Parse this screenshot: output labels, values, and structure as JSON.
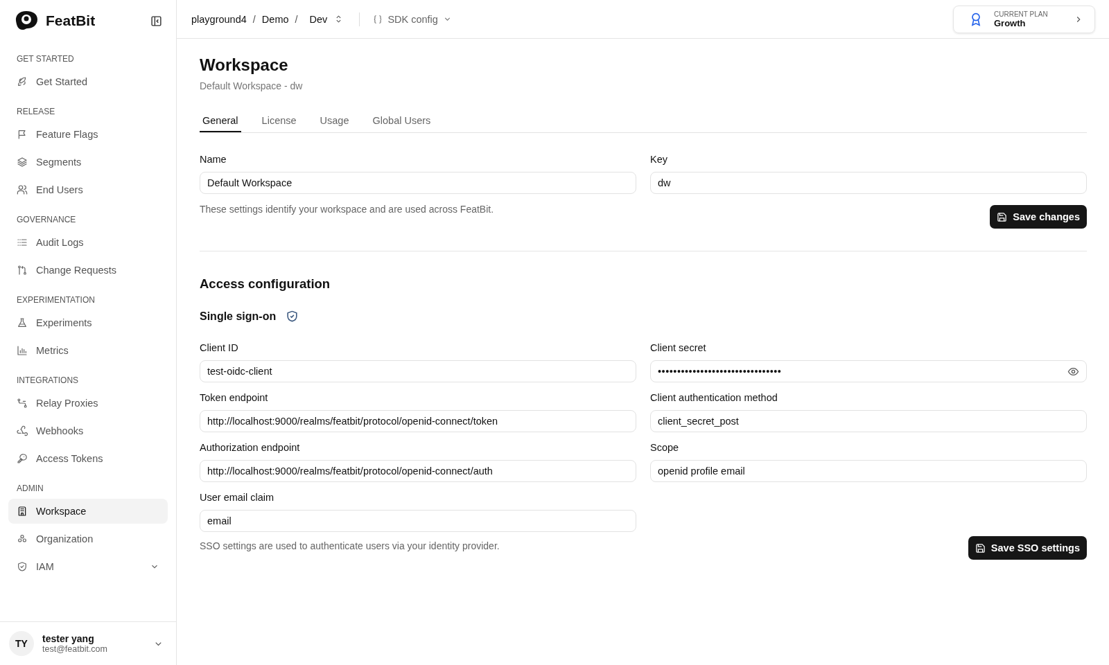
{
  "brand": {
    "name": "FeatBit"
  },
  "sidebar": {
    "sections": [
      {
        "title": "GET STARTED",
        "items": [
          {
            "label": "Get Started",
            "selected": false
          }
        ]
      },
      {
        "title": "RELEASE",
        "items": [
          {
            "label": "Feature Flags",
            "selected": false
          },
          {
            "label": "Segments",
            "selected": false
          },
          {
            "label": "End Users",
            "selected": false
          }
        ]
      },
      {
        "title": "GOVERNANCE",
        "items": [
          {
            "label": "Audit Logs",
            "selected": false
          },
          {
            "label": "Change Requests",
            "selected": false
          }
        ]
      },
      {
        "title": "EXPERIMENTATION",
        "items": [
          {
            "label": "Experiments",
            "selected": false
          },
          {
            "label": "Metrics",
            "selected": false
          }
        ]
      },
      {
        "title": "INTEGRATIONS",
        "items": [
          {
            "label": "Relay Proxies",
            "selected": false
          },
          {
            "label": "Webhooks",
            "selected": false
          },
          {
            "label": "Access Tokens",
            "selected": false
          }
        ]
      },
      {
        "title": "ADMIN",
        "items": [
          {
            "label": "Workspace",
            "selected": true
          },
          {
            "label": "Organization",
            "selected": false
          },
          {
            "label": "IAM",
            "selected": false,
            "expanded": false
          }
        ]
      }
    ],
    "user": {
      "initials": "TY",
      "name": "tester yang",
      "email": "test@featbit.com"
    }
  },
  "header": {
    "breadcrumb": [
      {
        "label": "playground4",
        "separator": "/"
      },
      {
        "label": "Demo",
        "separator": "/"
      }
    ],
    "environment": "Dev",
    "sdk_config": "SDK config",
    "plan": {
      "caption": "CURRENT PLAN",
      "name": "Growth"
    }
  },
  "page": {
    "title": "Workspace",
    "subtitle": "Default Workspace - dw",
    "tabs": [
      {
        "label": "General",
        "selected": true
      },
      {
        "label": "License",
        "selected": false
      },
      {
        "label": "Usage",
        "selected": false
      },
      {
        "label": "Global Users",
        "selected": false
      }
    ],
    "general": {
      "fields": [
        {
          "label": "Name",
          "value": "Default Workspace"
        },
        {
          "label": "Key",
          "value": "dw"
        }
      ],
      "note": "These settings identify your workspace and are used across FeatBit.",
      "button": "Save changes"
    },
    "access": {
      "title": "Access configuration",
      "sso_title": "Single sign-on",
      "fields": [
        {
          "label": "Client ID",
          "value": "test-oidc-client",
          "kind": "text"
        },
        {
          "label": "Client secret",
          "value": "••••••••••••••••••••••••••••••••",
          "kind": "password"
        },
        {
          "label": "Token endpoint",
          "value": "http://localhost:9000/realms/featbit/protocol/openid-connect/token",
          "kind": "text"
        },
        {
          "label": "Client authentication method",
          "value": "client_secret_post",
          "kind": "text"
        },
        {
          "label": "Authorization endpoint",
          "value": "http://localhost:9000/realms/featbit/protocol/openid-connect/auth",
          "kind": "text"
        },
        {
          "label": "Scope",
          "value": "openid profile email",
          "kind": "text"
        },
        {
          "label": "User email claim",
          "value": "email",
          "kind": "text"
        }
      ],
      "note": "SSO settings are used to authenticate users via your identity provider.",
      "button": "Save SSO settings"
    }
  }
}
